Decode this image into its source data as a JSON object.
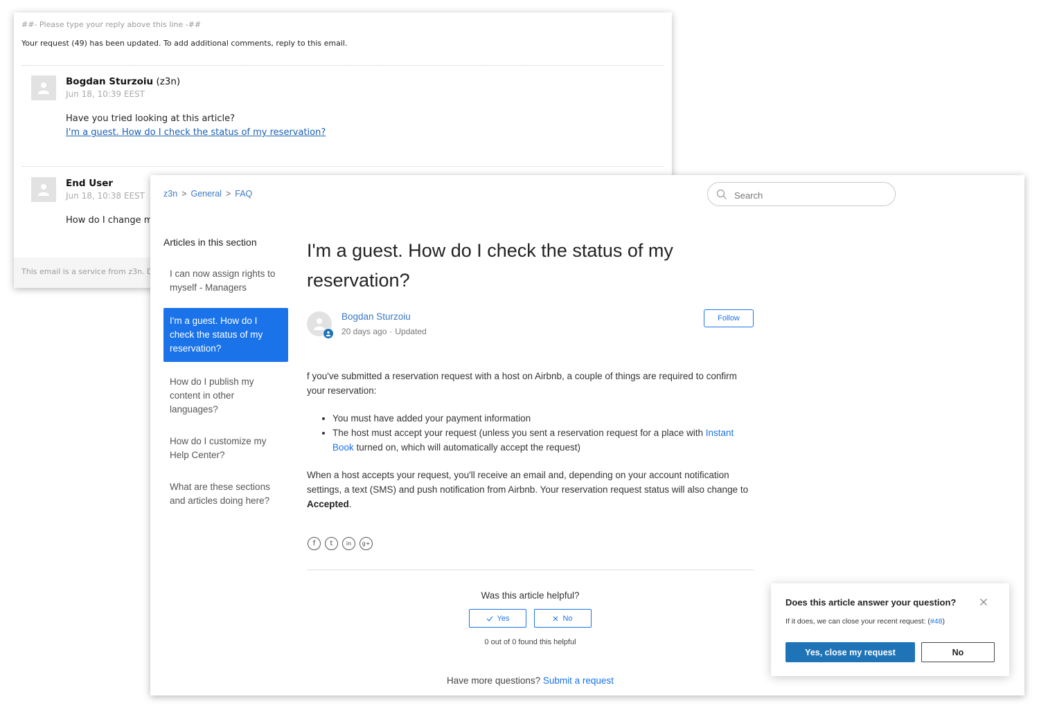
{
  "email": {
    "reply_line": "##- Please type your reply above this line -##",
    "updated_notice": "Your request (49) has been updated. To add additional comments, reply to this email.",
    "comments": [
      {
        "author": "Bogdan Sturzoiu",
        "handle": "(z3n)",
        "date": "Jun 18, 10:39 EEST",
        "body": "Have you tried looking at this article?",
        "link": "I'm a guest. How do I check the status of my reservation?"
      },
      {
        "author": "End User",
        "date": "Jun 18, 10:38 EEST",
        "body": "How do I change my"
      }
    ],
    "footer": "This email is a service from z3n. D"
  },
  "help_center": {
    "breadcrumb": [
      "z3n",
      "General",
      "FAQ"
    ],
    "search_placeholder": "Search",
    "section_title": "Articles in this section",
    "articles": [
      {
        "label": "I can now assign rights to myself - Managers"
      },
      {
        "label": "I'm a guest. How do I check the status of my reservation?"
      },
      {
        "label": "How do I publish my content in other languages?"
      },
      {
        "label": "How do I customize my Help Center?"
      },
      {
        "label": "What are these sections and articles doing here?"
      }
    ],
    "article": {
      "title": "I'm a guest. How do I check the status of my reservation?",
      "author": "Bogdan Sturzoiu",
      "age": "20 days ago",
      "dot": "·",
      "status": "Updated",
      "follow_label": "Follow",
      "intro": "f you've submitted a reservation request with a host on Airbnb, a couple of things are required to confirm your reservation:",
      "bullets": {
        "one": "You must have added your payment information",
        "two_before": "The host must accept your request (unless you sent a reservation request for a place with ",
        "two_link": "Instant Book",
        "two_after": " turned on, which will automatically accept the request)"
      },
      "outro_before": "When a host accepts your request, you'll receive an email and, depending on your account notification settings, a text (SMS) and push notification from Airbnb. Your reservation request status will also change to ",
      "outro_bold": "Accepted",
      "outro_after": "."
    },
    "share_icons": [
      "facebook-icon",
      "twitter-icon",
      "linkedin-icon",
      "googleplus-icon"
    ],
    "share_glyphs": {
      "facebook": "f",
      "twitter": "t",
      "linkedin": "in",
      "googleplus": "g+"
    },
    "helpful": {
      "question": "Was this article helpful?",
      "yes": "Yes",
      "no": "No",
      "count": "0 out of 0 found this helpful"
    },
    "more_questions": "Have more questions?",
    "submit_request": "Submit a request"
  },
  "popup": {
    "title": "Does this article answer your question?",
    "text_before": "If it does, we can close your recent request: (",
    "request_link": "#48",
    "text_after": ")",
    "yes_label": "Yes, close my request",
    "no_label": "No"
  },
  "colors": {
    "accent": "#1a73e8",
    "popup_primary": "#1f73b7",
    "link": "#3b78c3"
  }
}
